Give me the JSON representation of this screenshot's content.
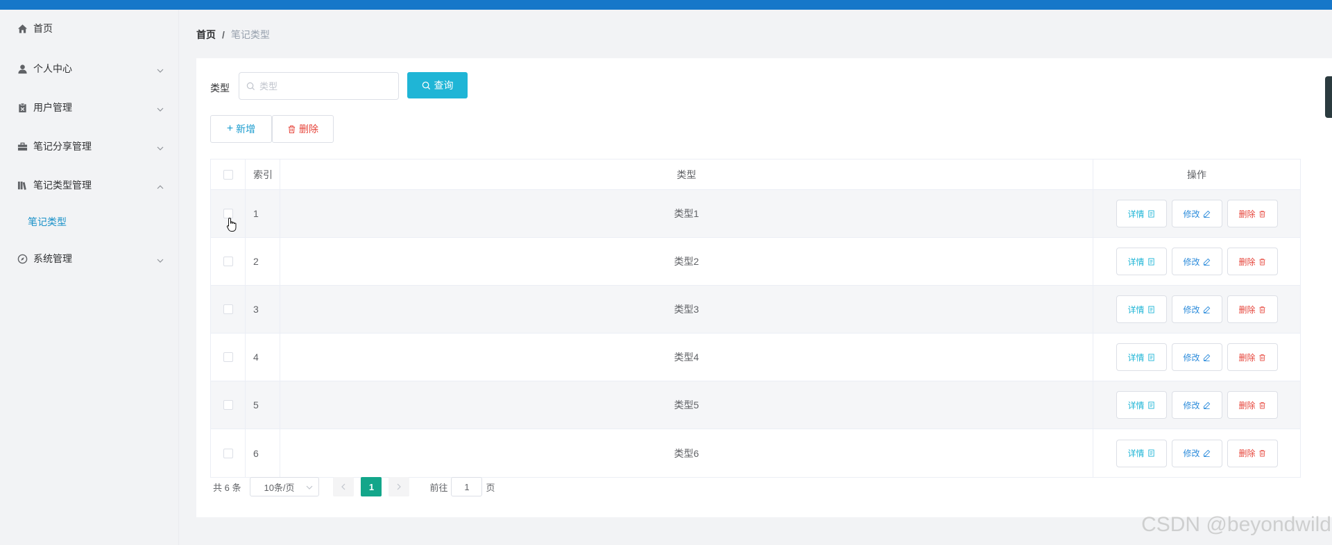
{
  "sidebar": {
    "items": [
      {
        "label": "首页",
        "icon": "home-icon"
      },
      {
        "label": "个人中心",
        "icon": "user-icon"
      },
      {
        "label": "用户管理",
        "icon": "clipboard-icon"
      },
      {
        "label": "笔记分享管理",
        "icon": "briefcase-icon"
      },
      {
        "label": "笔记类型管理",
        "icon": "books-icon"
      },
      {
        "label": "系统管理",
        "icon": "compass-icon"
      }
    ],
    "submenu": {
      "label": "笔记类型"
    }
  },
  "breadcrumb": {
    "home": "首页",
    "separator": "/",
    "current": "笔记类型"
  },
  "search": {
    "label": "类型",
    "placeholder": "类型",
    "value": "",
    "button_label": "查询"
  },
  "actions": {
    "add_label": "新增",
    "delete_label": "删除"
  },
  "table": {
    "columns": {
      "index": "索引",
      "type": "类型",
      "ops": "操作"
    },
    "op_labels": {
      "detail": "详情",
      "edit": "修改",
      "delete": "删除"
    },
    "rows": [
      {
        "index": "1",
        "type": "类型1"
      },
      {
        "index": "2",
        "type": "类型2"
      },
      {
        "index": "3",
        "type": "类型3"
      },
      {
        "index": "4",
        "type": "类型4"
      },
      {
        "index": "5",
        "type": "类型5"
      },
      {
        "index": "6",
        "type": "类型6"
      }
    ]
  },
  "pagination": {
    "total": "共 6 条",
    "page_size": "10条/页",
    "current_page": "1",
    "goto_label": "前往",
    "goto_value": "1",
    "page_suffix": "页"
  },
  "watermark": "CSDN @beyondwild",
  "colors": {
    "accent": "#1fb5d6",
    "danger": "#e6443a",
    "edit": "#2d8cdb",
    "active_page": "#13a68a",
    "topbar": "#1677c9"
  }
}
